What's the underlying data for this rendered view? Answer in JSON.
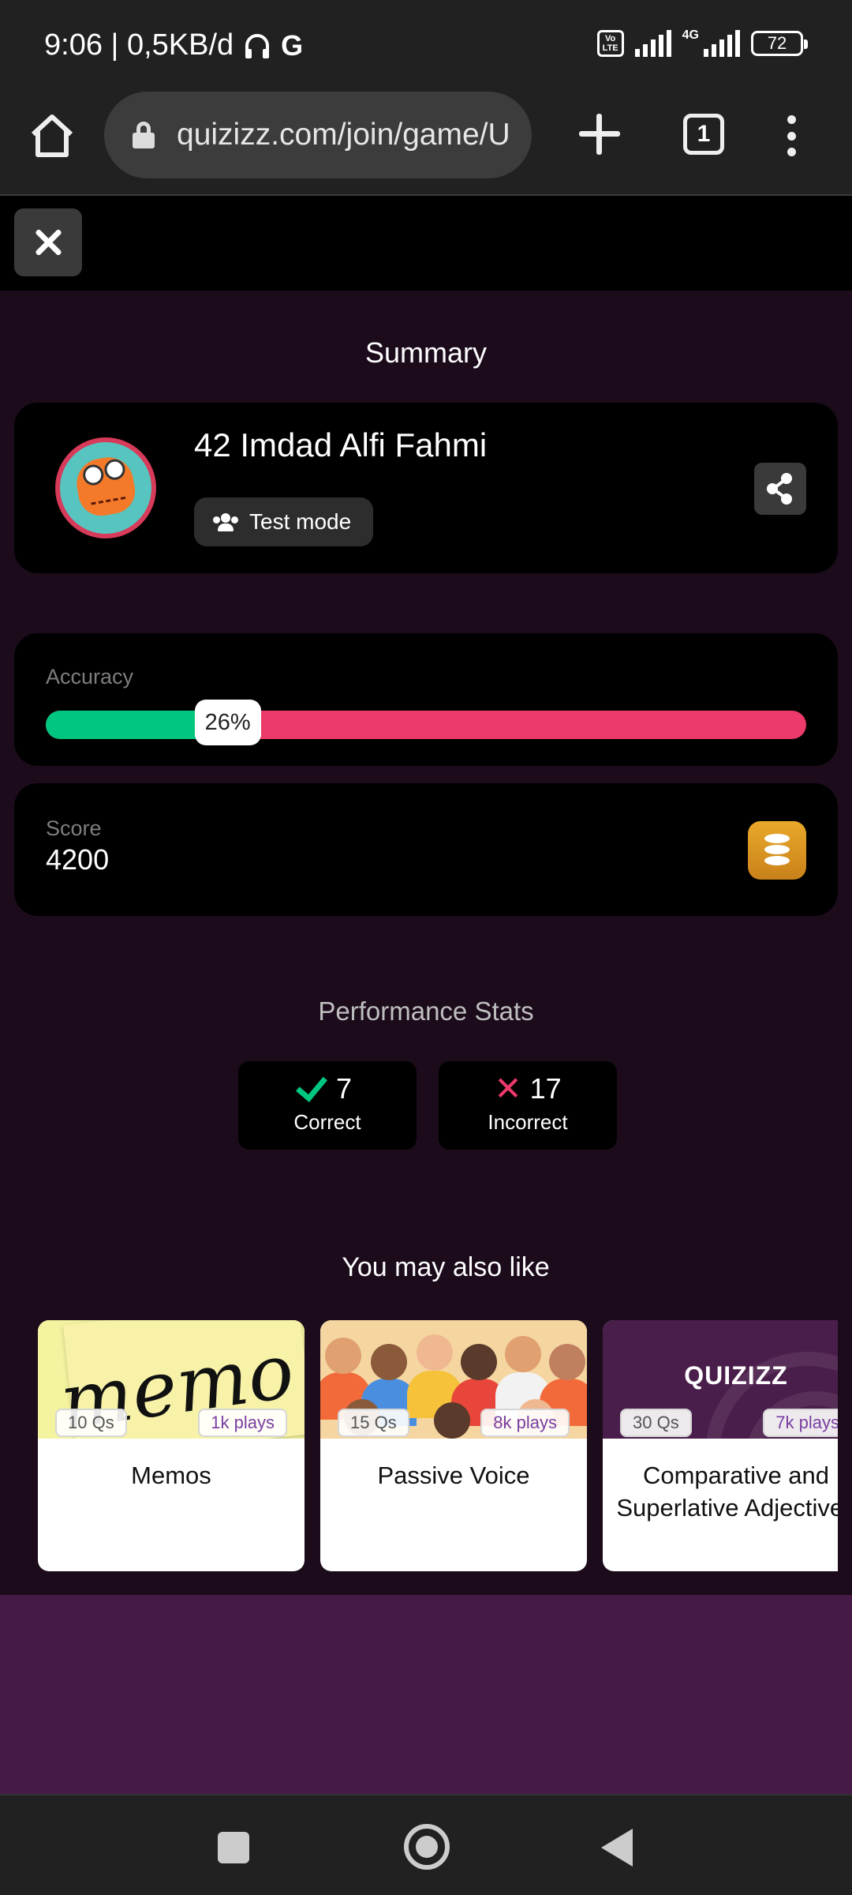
{
  "status_bar": {
    "time_and_speed": "9:06 | 0,5KB/d",
    "g_icon": "G",
    "volte": "Vo LTE",
    "network": "4G",
    "battery": "72"
  },
  "browser": {
    "url": "quizizz.com/join/game/U",
    "tab_count": "1",
    "icons": [
      "home-icon",
      "lock-icon",
      "plus-icon",
      "tabs-icon",
      "menu-icon"
    ]
  },
  "summary": {
    "title": "Summary",
    "player_name": "42 Imdad Alfi Fahmi",
    "mode": "Test mode"
  },
  "accuracy": {
    "label": "Accuracy",
    "value_text": "26%",
    "value": 0.26
  },
  "score": {
    "label": "Score",
    "value": "4200"
  },
  "performance": {
    "title": "Performance Stats",
    "correct_count": "7",
    "correct_label": "Correct",
    "incorrect_count": "17",
    "incorrect_label": "Incorrect"
  },
  "recommendations": {
    "title": "You may also like",
    "items": [
      {
        "name": "Memos",
        "questions": "10 Qs",
        "plays": "1k plays",
        "image_text": "memo"
      },
      {
        "name": "Passive Voice",
        "questions": "15 Qs",
        "plays": "8k plays"
      },
      {
        "name": "Comparative and Superlative Adjectives",
        "questions": "30 Qs",
        "plays": "7k plays",
        "image_text": "QUIZIZZ"
      }
    ]
  },
  "colors": {
    "accent_correct": "#00c67f",
    "accent_incorrect": "#ec3a6a",
    "page_bg": "#1b0b1b",
    "footer_bg": "#461a46"
  }
}
